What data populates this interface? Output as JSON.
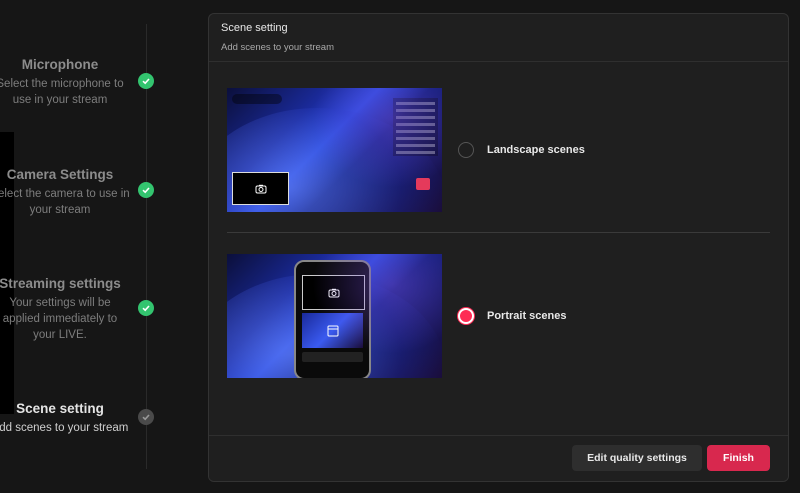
{
  "steps": [
    {
      "title": "Microphone",
      "desc": "Select the microphone to use in your stream",
      "status": "done"
    },
    {
      "title": "Camera Settings",
      "desc": "Select the camera to use in your stream",
      "status": "done"
    },
    {
      "title": "Streaming settings",
      "desc": "Your settings will be applied immediately to your LIVE.",
      "status": "done"
    },
    {
      "title": "Scene setting",
      "desc": "Add scenes to your stream",
      "status": "current"
    }
  ],
  "panel": {
    "title": "Scene setting",
    "subtitle": "Add scenes to your stream"
  },
  "options": {
    "landscape": {
      "label": "Landscape scenes",
      "selected": false
    },
    "portrait": {
      "label": "Portrait scenes",
      "selected": true
    }
  },
  "footer": {
    "edit_quality_label": "Edit quality settings",
    "finish_label": "Finish"
  },
  "colors": {
    "accent": "#d8284e",
    "check": "#33c46f"
  }
}
